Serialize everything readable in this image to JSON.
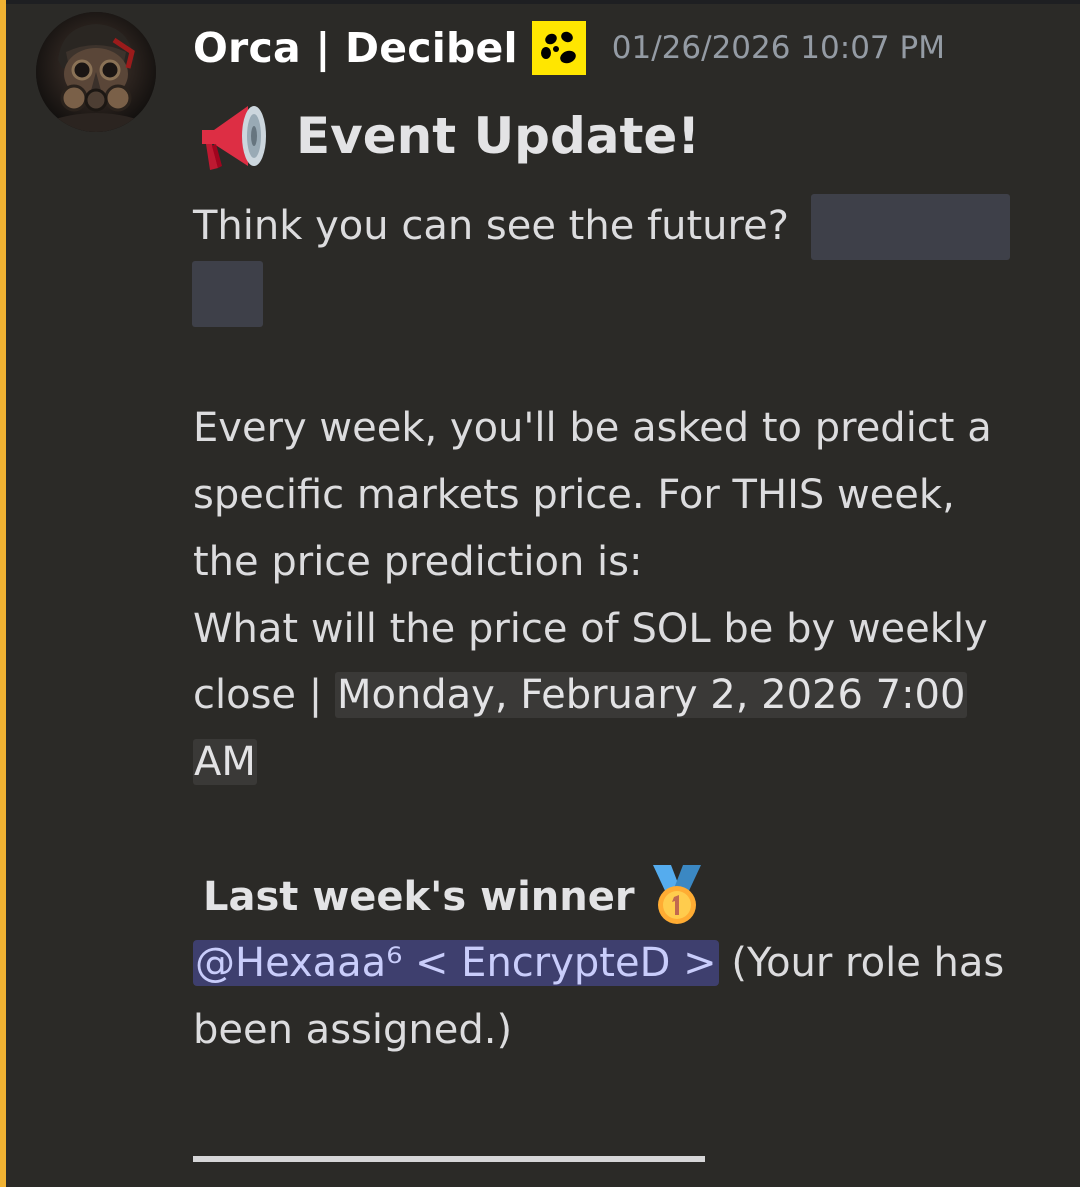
{
  "author": {
    "name": "Orca | Decibel",
    "timestamp": "01/26/2026 10:07 PM",
    "avatar_icon": "gas-mask-soldier-avatar",
    "server_tag_icon": "decibel-server-tag-icon"
  },
  "message": {
    "heading_emoji": "megaphone-emoji",
    "heading": "Event Update!",
    "intro": "Think you can see the future?",
    "para1": "Every week, you'll be asked to predict a",
    "para2": "specific markets price. For THIS week,",
    "para3": "the price prediction is:",
    "para4": "What will the price of SOL be by weekly",
    "close_prefix": "close | ",
    "close_time_line1": "Monday, February 2, 2026 7:00",
    "close_time_line2": "AM",
    "winner_label": "Last week's winner",
    "winner_emoji": "first-place-medal-emoji",
    "winner_mention": "@Hexaaa⁶ < EncrypteD >",
    "winner_suffix": " (Your role has",
    "winner_suffix2": "been assigned.)"
  },
  "colors": {
    "background": "#2b2a27",
    "mention_highlight_bar": "#f0b232",
    "spoiler": "#3e4049",
    "mention_bg": "#3e3f6e",
    "mention_text": "#c9cdfb",
    "tag_yellow": "#ffe600"
  }
}
